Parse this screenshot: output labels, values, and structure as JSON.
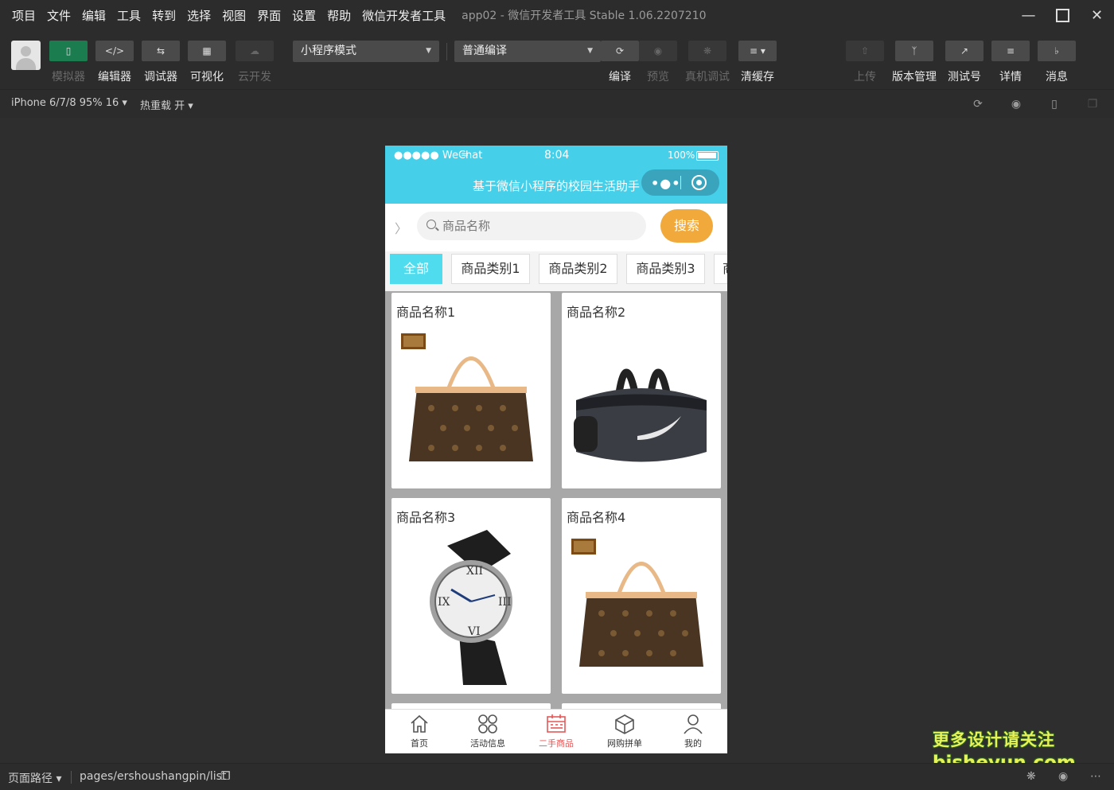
{
  "menubar": {
    "items": [
      "项目",
      "文件",
      "编辑",
      "工具",
      "转到",
      "选择",
      "视图",
      "界面",
      "设置",
      "帮助",
      "微信开发者工具"
    ],
    "window_title": "app02 - 微信开发者工具 Stable 1.06.2207210"
  },
  "toolbar": {
    "simulator": "模拟器",
    "editor": "编辑器",
    "debugger": "调试器",
    "visual": "可视化",
    "cloud": "云开发",
    "mode_select": "小程序模式",
    "compile_select": "普通编译",
    "compile": "编译",
    "preview": "预览",
    "remote_debug": "真机调试",
    "clear_cache": "清缓存",
    "upload": "上传",
    "version": "版本管理",
    "test": "测试号",
    "details": "详情",
    "messages": "消息"
  },
  "subbar": {
    "device": "iPhone 6/7/8 95% 16",
    "hot_reload": "热重载 开"
  },
  "phone": {
    "status": {
      "carrier": "●●●●● WeChat",
      "time": "8:04",
      "battery": "100%"
    },
    "nav_title": "基于微信小程序的校园生活助手",
    "search": {
      "placeholder": "商品名称",
      "button": "搜索"
    },
    "tabs": [
      "全部",
      "商品类别1",
      "商品类别2",
      "商品类别3",
      "商"
    ],
    "products": [
      {
        "name": "商品名称1",
        "image": "tote-bag"
      },
      {
        "name": "商品名称2",
        "image": "sports-duffel"
      },
      {
        "name": "商品名称3",
        "image": "wristwatch"
      },
      {
        "name": "商品名称4",
        "image": "tote-bag"
      }
    ],
    "tabbar": [
      {
        "label": "首页",
        "icon": "home-icon"
      },
      {
        "label": "活动信息",
        "icon": "grid-icon"
      },
      {
        "label": "二手商品",
        "icon": "calendar-icon"
      },
      {
        "label": "网购拼单",
        "icon": "cube-icon"
      },
      {
        "label": "我的",
        "icon": "user-icon"
      }
    ]
  },
  "bottombar": {
    "page_path_label": "页面路径",
    "page_path": "pages/ershoushangpin/list"
  },
  "watermark": {
    "line1": "更多设计请关注",
    "line2": "bisheyun.com"
  },
  "colors": {
    "accent": "#45cfe9",
    "search_button": "#f0a93a",
    "active_tab": "#4fdcee",
    "active_tabbar": "#e45858"
  }
}
